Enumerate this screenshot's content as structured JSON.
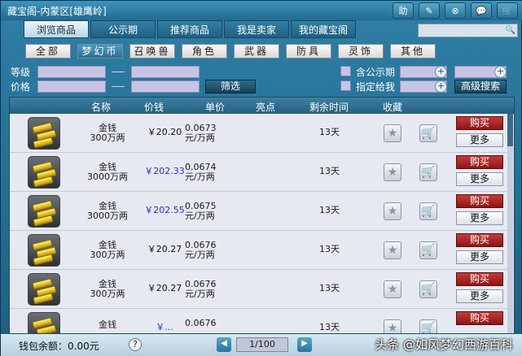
{
  "window": {
    "title": "藏宝阁-内蒙区[雄鹰岭]"
  },
  "top_icons": [
    "助",
    "✎",
    "⊗",
    "💬",
    "🛒"
  ],
  "main_tabs": [
    "浏览商品",
    "公示期",
    "推荐商品",
    "我是卖家",
    "我的藏宝阁"
  ],
  "search": {
    "placeholder": ""
  },
  "categories": [
    "全部",
    "梦幻币",
    "召唤兽",
    "角色",
    "武器",
    "防具",
    "灵饰",
    "其他"
  ],
  "filters": {
    "level_label": "等级",
    "price_label": "价格",
    "filter_button": "筛选",
    "public_label": "含公示期",
    "assign_label": "指定给我",
    "advanced_search": "高级搜索"
  },
  "table": {
    "headers": [
      "名称",
      "价钱",
      "单价",
      "亮点",
      "剩余时间",
      "收藏"
    ],
    "rows": [
      {
        "name": "金钱",
        "amount": "300万两",
        "price": "￥20.20",
        "price_color": "black",
        "unit1": "0.0673",
        "unit2": "元/万两",
        "time": "13天",
        "buy": "购买",
        "more": "更多"
      },
      {
        "name": "金钱",
        "amount": "3000万两",
        "price": "￥202.33",
        "price_color": "blue",
        "unit1": "0.0674",
        "unit2": "元/万两",
        "time": "13天",
        "buy": "购买",
        "more": "更多"
      },
      {
        "name": "金钱",
        "amount": "3000万两",
        "price": "￥202.55",
        "price_color": "blue",
        "unit1": "0.0675",
        "unit2": "元/万两",
        "time": "13天",
        "buy": "购买",
        "more": "更多"
      },
      {
        "name": "金钱",
        "amount": "300万两",
        "price": "￥20.27",
        "price_color": "black",
        "unit1": "0.0676",
        "unit2": "元/万两",
        "time": "13天",
        "buy": "购买",
        "more": "更多"
      },
      {
        "name": "金钱",
        "amount": "300万两",
        "price": "￥20.27",
        "price_color": "black",
        "unit1": "0.0676",
        "unit2": "元/万两",
        "time": "13天",
        "buy": "购买",
        "more": "更多"
      },
      {
        "name": "金钱",
        "amount": "",
        "price": "￥...",
        "price_color": "blue",
        "unit1": "0.0676",
        "unit2": "",
        "time": "13天",
        "buy": "购买",
        "more": ""
      }
    ]
  },
  "footer": {
    "wallet": "钱包余额：0.00元",
    "help": "?",
    "page": "1/100",
    "watermark": "头条 @如风梦幻西游百科"
  }
}
